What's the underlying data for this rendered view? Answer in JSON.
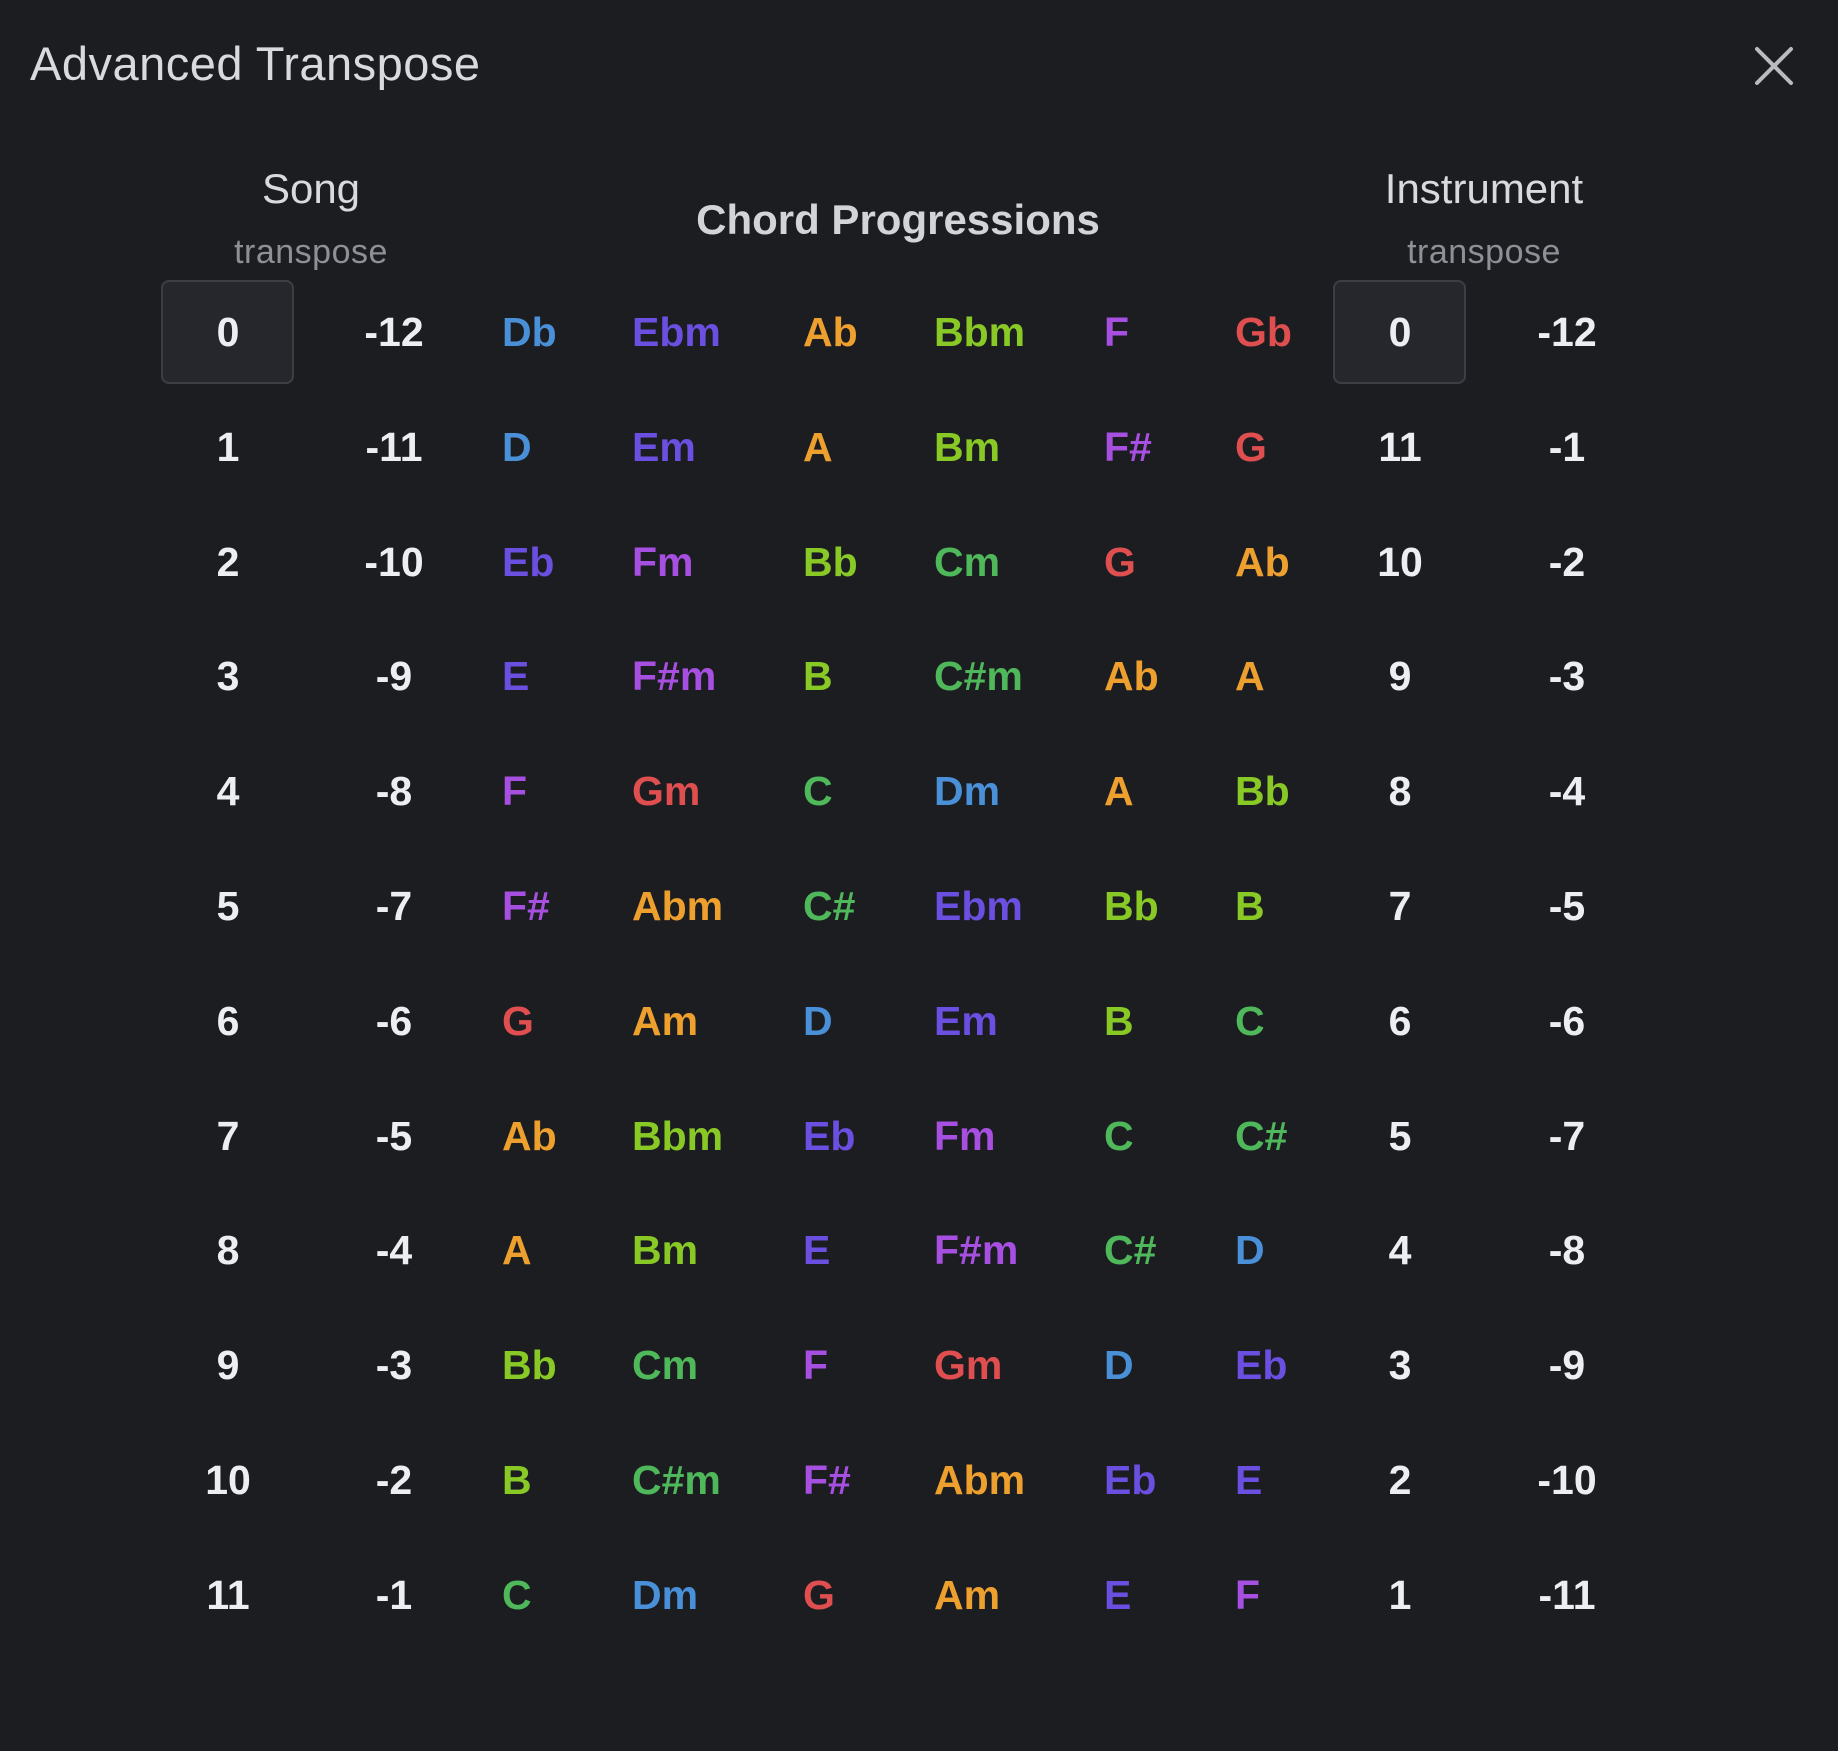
{
  "dialog": {
    "title": "Advanced Transpose"
  },
  "headers": {
    "song_title": "Song",
    "song_sub": "transpose",
    "center_title": "Chord Progressions",
    "instrument_title": "Instrument",
    "instrument_sub": "transpose"
  },
  "colors": {
    "background": "#1c1d21",
    "text": "#eceef2",
    "chord_blue": "#4a90d9",
    "chord_indigo": "#6b4fe0",
    "chord_purple": "#a64fe0",
    "chord_orange": "#eea02e",
    "chord_lime": "#88c926",
    "chord_green": "#4fb85a",
    "chord_red": "#df4f4f"
  },
  "rows": [
    {
      "song": "0",
      "song_neg": "-12",
      "chords": [
        {
          "n": "Db",
          "c": "blue"
        },
        {
          "n": "Ebm",
          "c": "indigo"
        },
        {
          "n": "Ab",
          "c": "orange"
        },
        {
          "n": "Bbm",
          "c": "lime"
        },
        {
          "n": "F",
          "c": "purple"
        },
        {
          "n": "Gb",
          "c": "red"
        }
      ],
      "inst": "0",
      "inst_neg": "-12"
    },
    {
      "song": "1",
      "song_neg": "-11",
      "chords": [
        {
          "n": "D",
          "c": "blue"
        },
        {
          "n": "Em",
          "c": "indigo"
        },
        {
          "n": "A",
          "c": "orange"
        },
        {
          "n": "Bm",
          "c": "lime"
        },
        {
          "n": "F#",
          "c": "purple"
        },
        {
          "n": "G",
          "c": "red"
        }
      ],
      "inst": "11",
      "inst_neg": "-1"
    },
    {
      "song": "2",
      "song_neg": "-10",
      "chords": [
        {
          "n": "Eb",
          "c": "indigo"
        },
        {
          "n": "Fm",
          "c": "purple"
        },
        {
          "n": "Bb",
          "c": "lime"
        },
        {
          "n": "Cm",
          "c": "green"
        },
        {
          "n": "G",
          "c": "red"
        },
        {
          "n": "Ab",
          "c": "orange"
        }
      ],
      "inst": "10",
      "inst_neg": "-2"
    },
    {
      "song": "3",
      "song_neg": "-9",
      "chords": [
        {
          "n": "E",
          "c": "indigo"
        },
        {
          "n": "F#m",
          "c": "purple"
        },
        {
          "n": "B",
          "c": "lime"
        },
        {
          "n": "C#m",
          "c": "green"
        },
        {
          "n": "Ab",
          "c": "orange"
        },
        {
          "n": "A",
          "c": "orange"
        }
      ],
      "inst": "9",
      "inst_neg": "-3"
    },
    {
      "song": "4",
      "song_neg": "-8",
      "chords": [
        {
          "n": "F",
          "c": "purple"
        },
        {
          "n": "Gm",
          "c": "red"
        },
        {
          "n": "C",
          "c": "green"
        },
        {
          "n": "Dm",
          "c": "blue"
        },
        {
          "n": "A",
          "c": "orange"
        },
        {
          "n": "Bb",
          "c": "lime"
        }
      ],
      "inst": "8",
      "inst_neg": "-4"
    },
    {
      "song": "5",
      "song_neg": "-7",
      "chords": [
        {
          "n": "F#",
          "c": "purple"
        },
        {
          "n": "Abm",
          "c": "orange"
        },
        {
          "n": "C#",
          "c": "green"
        },
        {
          "n": "Ebm",
          "c": "indigo"
        },
        {
          "n": "Bb",
          "c": "lime"
        },
        {
          "n": "B",
          "c": "lime"
        }
      ],
      "inst": "7",
      "inst_neg": "-5"
    },
    {
      "song": "6",
      "song_neg": "-6",
      "chords": [
        {
          "n": "G",
          "c": "red"
        },
        {
          "n": "Am",
          "c": "orange"
        },
        {
          "n": "D",
          "c": "blue"
        },
        {
          "n": "Em",
          "c": "indigo"
        },
        {
          "n": "B",
          "c": "lime"
        },
        {
          "n": "C",
          "c": "green"
        }
      ],
      "inst": "6",
      "inst_neg": "-6"
    },
    {
      "song": "7",
      "song_neg": "-5",
      "chords": [
        {
          "n": "Ab",
          "c": "orange"
        },
        {
          "n": "Bbm",
          "c": "lime"
        },
        {
          "n": "Eb",
          "c": "indigo"
        },
        {
          "n": "Fm",
          "c": "purple"
        },
        {
          "n": "C",
          "c": "green"
        },
        {
          "n": "C#",
          "c": "green"
        }
      ],
      "inst": "5",
      "inst_neg": "-7"
    },
    {
      "song": "8",
      "song_neg": "-4",
      "chords": [
        {
          "n": "A",
          "c": "orange"
        },
        {
          "n": "Bm",
          "c": "lime"
        },
        {
          "n": "E",
          "c": "indigo"
        },
        {
          "n": "F#m",
          "c": "purple"
        },
        {
          "n": "C#",
          "c": "green"
        },
        {
          "n": "D",
          "c": "blue"
        }
      ],
      "inst": "4",
      "inst_neg": "-8"
    },
    {
      "song": "9",
      "song_neg": "-3",
      "chords": [
        {
          "n": "Bb",
          "c": "lime"
        },
        {
          "n": "Cm",
          "c": "green"
        },
        {
          "n": "F",
          "c": "purple"
        },
        {
          "n": "Gm",
          "c": "red"
        },
        {
          "n": "D",
          "c": "blue"
        },
        {
          "n": "Eb",
          "c": "indigo"
        }
      ],
      "inst": "3",
      "inst_neg": "-9"
    },
    {
      "song": "10",
      "song_neg": "-2",
      "chords": [
        {
          "n": "B",
          "c": "lime"
        },
        {
          "n": "C#m",
          "c": "green"
        },
        {
          "n": "F#",
          "c": "purple"
        },
        {
          "n": "Abm",
          "c": "orange"
        },
        {
          "n": "Eb",
          "c": "indigo"
        },
        {
          "n": "E",
          "c": "indigo"
        }
      ],
      "inst": "2",
      "inst_neg": "-10"
    },
    {
      "song": "11",
      "song_neg": "-1",
      "chords": [
        {
          "n": "C",
          "c": "green"
        },
        {
          "n": "Dm",
          "c": "blue"
        },
        {
          "n": "G",
          "c": "red"
        },
        {
          "n": "Am",
          "c": "orange"
        },
        {
          "n": "E",
          "c": "indigo"
        },
        {
          "n": "F",
          "c": "purple"
        }
      ],
      "inst": "1",
      "inst_neg": "-11"
    }
  ]
}
